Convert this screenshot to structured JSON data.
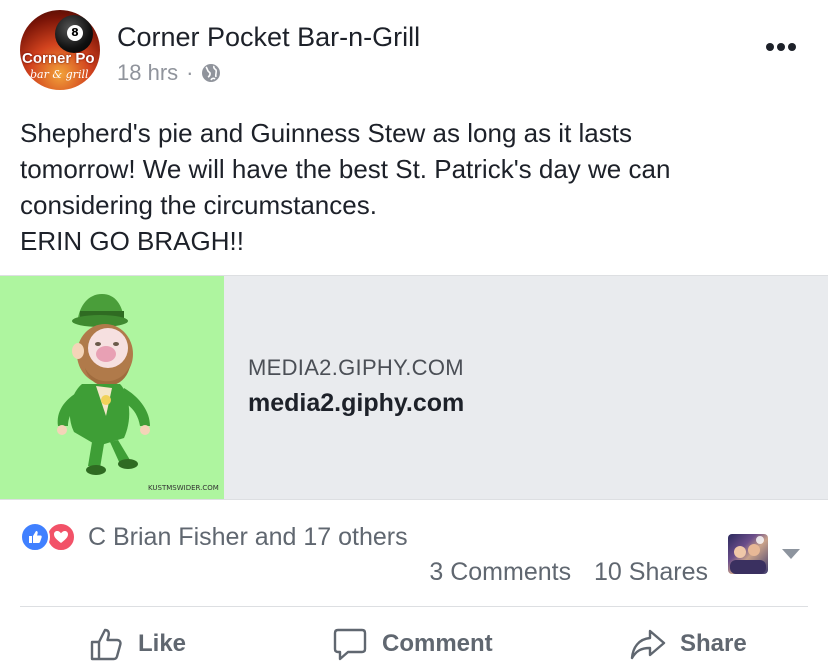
{
  "post": {
    "page_name": "Corner Pocket Bar-n-Grill",
    "avatar_text_line1": "Corner Po",
    "avatar_text_line2": "bar & grill",
    "avatar_ball_number": "8",
    "time": "18 hrs",
    "separator": "·",
    "privacy_icon": "globe-icon",
    "text_lines": [
      "Shepherd's pie and Guinness Stew as long as it lasts",
      "tomorrow! We will have the best St. Patrick's day we can",
      "considering the circumstances.",
      "ERIN GO BRAGH!!"
    ]
  },
  "link_preview": {
    "domain_caption": "MEDIA2.GIPHY.COM",
    "title": "media2.giphy.com",
    "gif_credit": "KUSTMSWIDER.COM",
    "thumb_bg": "#aef59f"
  },
  "engagement": {
    "reactions_text": "C Brian Fisher and 17 others",
    "comments": "3 Comments",
    "shares": "10 Shares",
    "like_color": "#4080ff",
    "love_color": "#f25268"
  },
  "actions": {
    "like": "Like",
    "comment": "Comment",
    "share": "Share"
  }
}
